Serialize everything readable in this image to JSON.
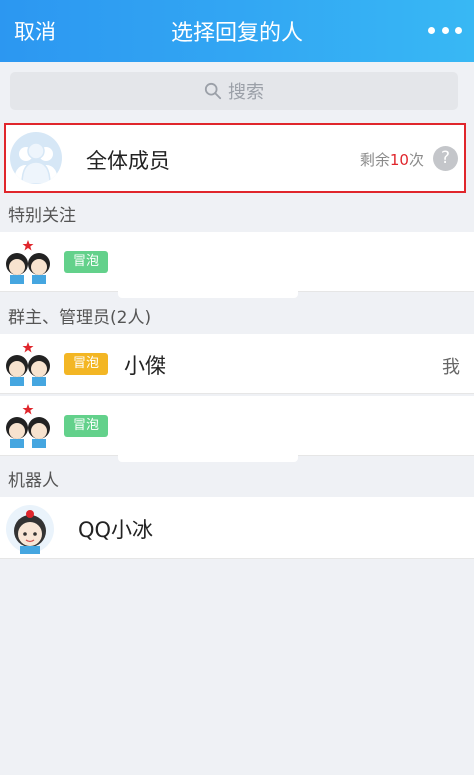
{
  "header": {
    "cancel_label": "取消",
    "title": "选择回复的人"
  },
  "search": {
    "label": "搜索"
  },
  "all_members": {
    "name": "全体成员",
    "remain_prefix": "剩余",
    "remain_count": "10",
    "remain_suffix": "次",
    "help_label": "?"
  },
  "sections": {
    "special": "特别关注",
    "admins": "群主、管理员(2人)",
    "robots": "机器人"
  },
  "members": [
    {
      "tag": "冒泡",
      "tag_color": "#63d18b",
      "name": "",
      "note": ""
    },
    {
      "tag": "冒泡",
      "tag_color": "#f3b624",
      "name": "小傑",
      "note": "我"
    },
    {
      "tag": "冒泡",
      "tag_color": "#63d18b",
      "name": "",
      "note": ""
    }
  ],
  "robot": {
    "name": "QQ小冰"
  },
  "colors": {
    "header_start": "#2c97f1",
    "header_end": "#38b8f4",
    "highlight_border": "#e0262c",
    "count_red": "#e0262c"
  }
}
